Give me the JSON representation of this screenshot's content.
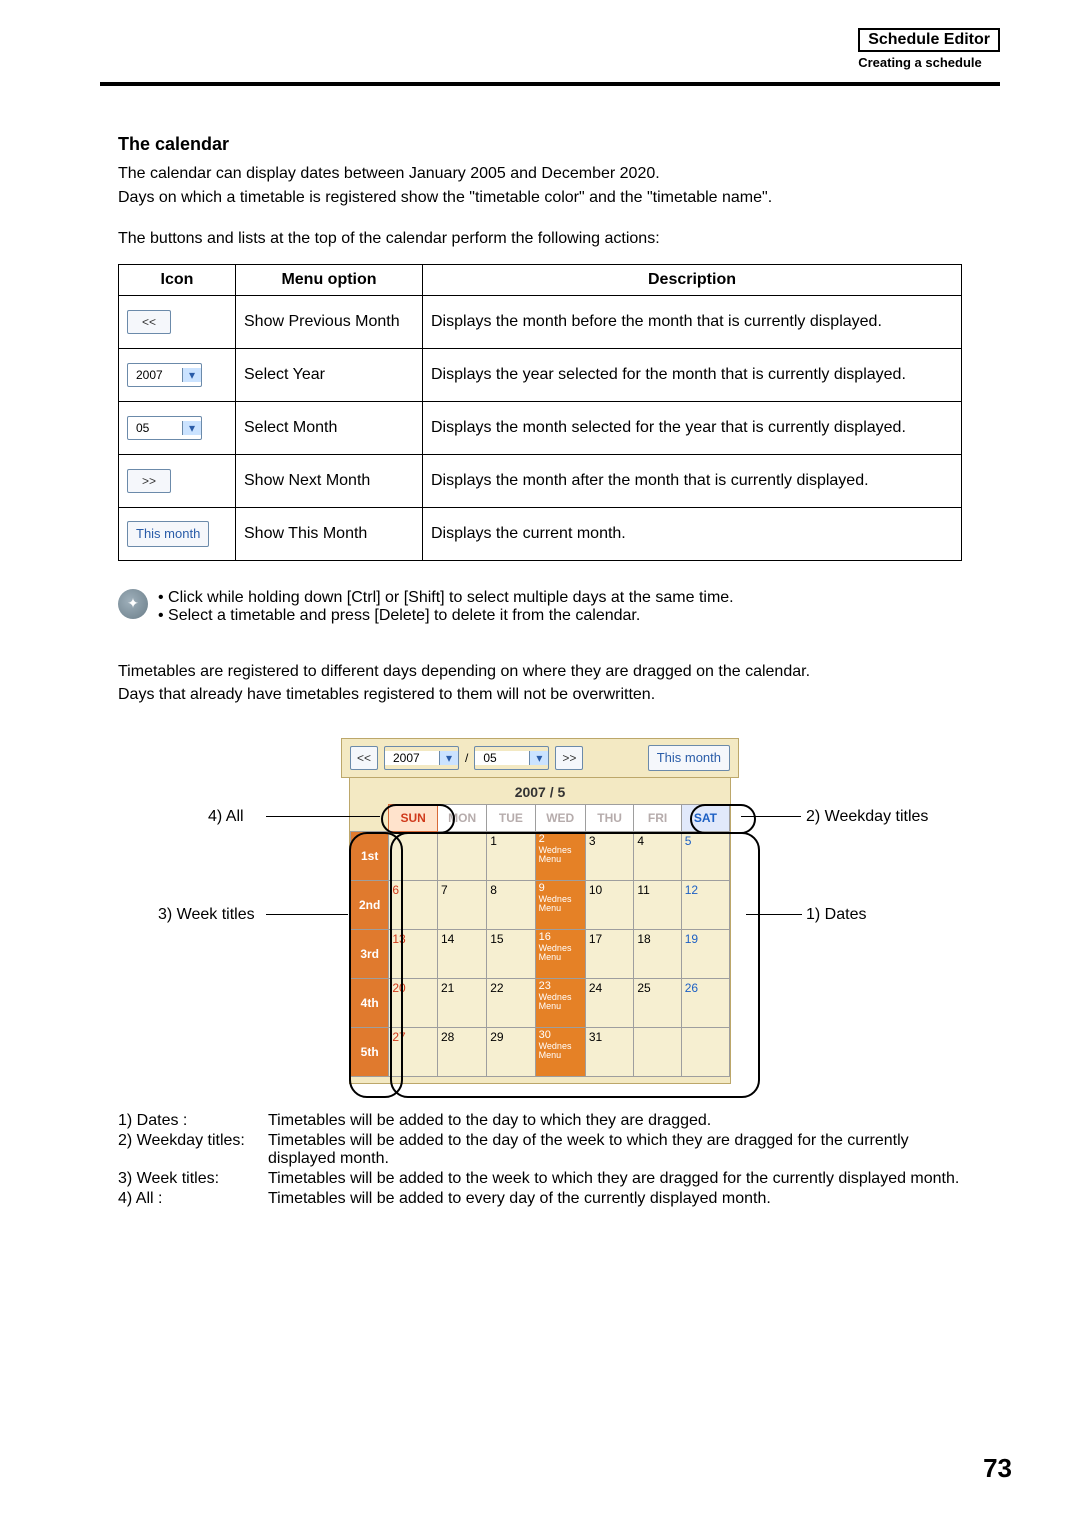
{
  "header": {
    "title": "Schedule Editor",
    "subtitle": "Creating a schedule"
  },
  "section_title": "The calendar",
  "intro_lines": [
    "The calendar can display dates between January 2005 and December 2020.",
    "Days on which a timetable is registered show the \"timetable color\" and the \"timetable name\"."
  ],
  "table_intro": "The buttons and lists at the top of the calendar perform the following actions:",
  "icon_table": {
    "headers": {
      "icon": "Icon",
      "menu": "Menu option",
      "desc": "Description"
    },
    "rows": [
      {
        "icon": "<<",
        "menu": "Show Previous Month",
        "desc": "Displays the month before the month that is currently displayed."
      },
      {
        "icon": "2007",
        "menu": "Select Year",
        "desc": "Displays the year selected for the month that is currently displayed.",
        "combo": true
      },
      {
        "icon": "05",
        "menu": "Select Month",
        "desc": "Displays the month selected for the year that is currently displayed.",
        "combo": true
      },
      {
        "icon": ">>",
        "menu": "Show Next Month",
        "desc": "Displays the month after the month that is currently displayed."
      },
      {
        "icon": "This month",
        "menu": "Show This Month",
        "desc": "Displays the current month.",
        "thismonth": true
      }
    ]
  },
  "hints": [
    "Click while holding down [Ctrl] or [Shift] to select multiple days at the same time.",
    "Select a timetable and press [Delete] to delete it from the calendar."
  ],
  "drag_note_lines": [
    "Timetables are registered to different days depending on where they are dragged on the calendar.",
    "Days that already have timetables registered to them will not be overwritten."
  ],
  "cal": {
    "toolbar": {
      "prev": "<<",
      "year": "2007",
      "sep": "/",
      "month": "05",
      "next": ">>",
      "thismonth": "This month"
    },
    "title": "2007 / 5",
    "weekday_headers": [
      "SUN",
      "MON",
      "TUE",
      "WED",
      "THU",
      "FRI",
      "SAT"
    ],
    "week_titles": [
      "1st",
      "2nd",
      "3rd",
      "4th",
      "5th"
    ],
    "wed_label": "Wednes Menu",
    "grid": [
      [
        "",
        "",
        "1",
        "2",
        "3",
        "4",
        "5"
      ],
      [
        "6",
        "7",
        "8",
        "9",
        "10",
        "11",
        "12"
      ],
      [
        "13",
        "14",
        "15",
        "16",
        "17",
        "18",
        "19"
      ],
      [
        "20",
        "21",
        "22",
        "23",
        "24",
        "25",
        "26"
      ],
      [
        "27",
        "28",
        "29",
        "30",
        "31",
        "",
        ""
      ]
    ]
  },
  "callouts": {
    "all": "4) All",
    "weekday_titles": "2) Weekday titles",
    "week_titles": "3) Week titles",
    "dates": "1) Dates"
  },
  "legend": [
    {
      "k": "1) Dates :",
      "v": "Timetables will be added to the day to which they are dragged."
    },
    {
      "k": "2) Weekday titles:",
      "v": "Timetables will be added to the day of the week to which they are dragged for the currently displayed month."
    },
    {
      "k": "3) Week titles:",
      "v": "Timetables will be added to the week to which they are dragged for the currently displayed month."
    },
    {
      "k": "4) All :",
      "v": "Timetables will be added to every day of the currently displayed month."
    }
  ],
  "page_number": "73"
}
